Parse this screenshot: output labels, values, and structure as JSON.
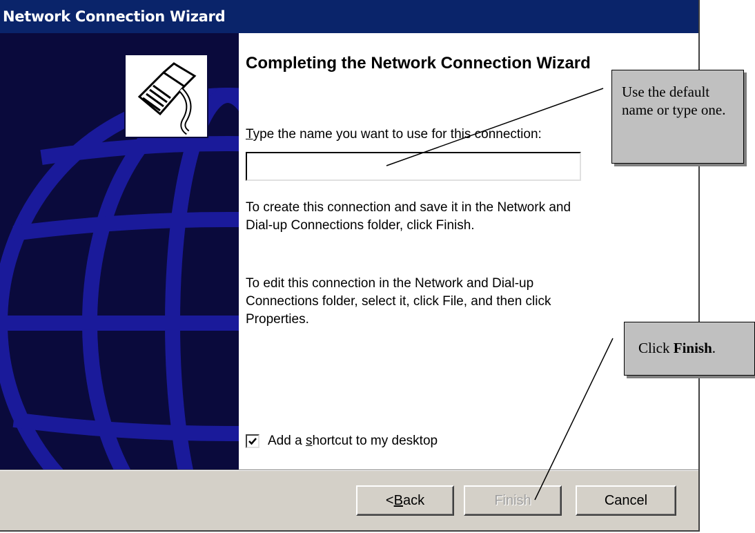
{
  "window": {
    "title": "Network Connection Wizard"
  },
  "wizard": {
    "heading": "Completing the Network Connection Wizard",
    "name_label_pre": "",
    "name_label_accel": "T",
    "name_label_post": "ype the name you want to use for this connection:",
    "name_input_value": "",
    "paragraph1": "To create this connection and save it in the Network and Dial-up Connections folder, click Finish.",
    "paragraph2": "To edit this connection in the Network and Dial-up Connections folder, select it, click File, and then click Properties.",
    "shortcut_checked": true,
    "shortcut_pre": "Add a ",
    "shortcut_accel": "s",
    "shortcut_post": "hortcut to my desktop"
  },
  "buttons": {
    "back_pre": "< ",
    "back_accel": "B",
    "back_post": "ack",
    "finish": "Finish",
    "cancel": "Cancel"
  },
  "callouts": {
    "name_hint": "Use the default name or type one.",
    "finish_hint_pre": "Click ",
    "finish_hint_bold": "Finish",
    "finish_hint_post": "."
  },
  "icons": {
    "banner_icon": "network-plug-icon",
    "checkbox_mark": "checkmark-icon"
  },
  "colors": {
    "titlebar": "#0a246a",
    "banner_bg": "#0a0a3c",
    "globe": "#1a1a9a",
    "dialog_face": "#d4d0c8",
    "callout_bg": "#c0c0c0"
  }
}
